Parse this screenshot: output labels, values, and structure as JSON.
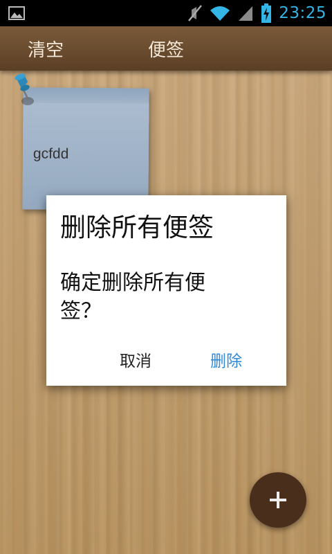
{
  "status_bar": {
    "time": "23:25",
    "icons": [
      "gallery-icon",
      "mute-icon",
      "wifi-icon",
      "signal-icon",
      "battery-charging-icon"
    ],
    "clock_color": "#33b5e5"
  },
  "action_bar": {
    "clear_label": "清空",
    "title": "便签"
  },
  "notes": [
    {
      "text": "gcfdd",
      "color": "#a5b6ca"
    }
  ],
  "dialog": {
    "title": "删除所有便签",
    "message": "确定删除所有便签？",
    "cancel_label": "取消",
    "delete_label": "删除",
    "accent": "#2f8ad8"
  },
  "fab": {
    "icon": "plus-icon"
  },
  "theme": {
    "wood": "#c4a173",
    "action_bar": "#6b4c30",
    "fab": "#4a2e1c"
  }
}
